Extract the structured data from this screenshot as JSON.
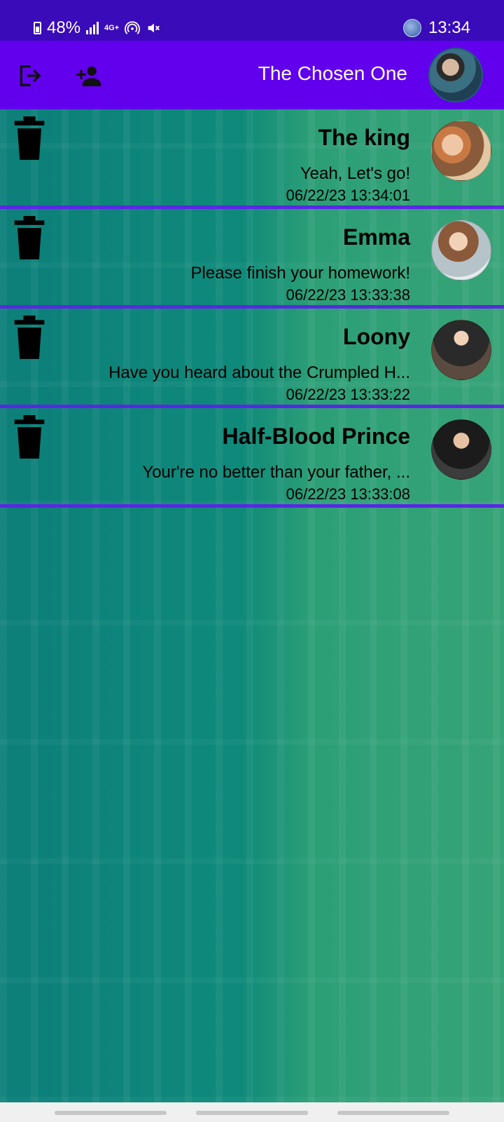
{
  "status_bar": {
    "battery": "48%",
    "network": "4G+",
    "time": "13:34"
  },
  "app_bar": {
    "title": "The Chosen One",
    "icons": [
      "logout-icon",
      "add-user-icon"
    ]
  },
  "chats": [
    {
      "name": "The king",
      "message": "Yeah, Let's go!",
      "timestamp": "06/22/23 13:34:01"
    },
    {
      "name": "Emma",
      "message": "Please finish your homework!",
      "timestamp": "06/22/23 13:33:38"
    },
    {
      "name": "Loony",
      "message": "Have you heard about the Crumpled H...",
      "timestamp": "06/22/23 13:33:22"
    },
    {
      "name": "Half-Blood Prince",
      "message": "Your're no better than your father, ...",
      "timestamp": "06/22/23 13:33:08"
    }
  ],
  "colors": {
    "status_bar": "#3a0bb8",
    "app_bar": "#6200ee",
    "divider": "#5a27e4",
    "background_start": "#0c7f79",
    "background_end": "#37a377"
  }
}
